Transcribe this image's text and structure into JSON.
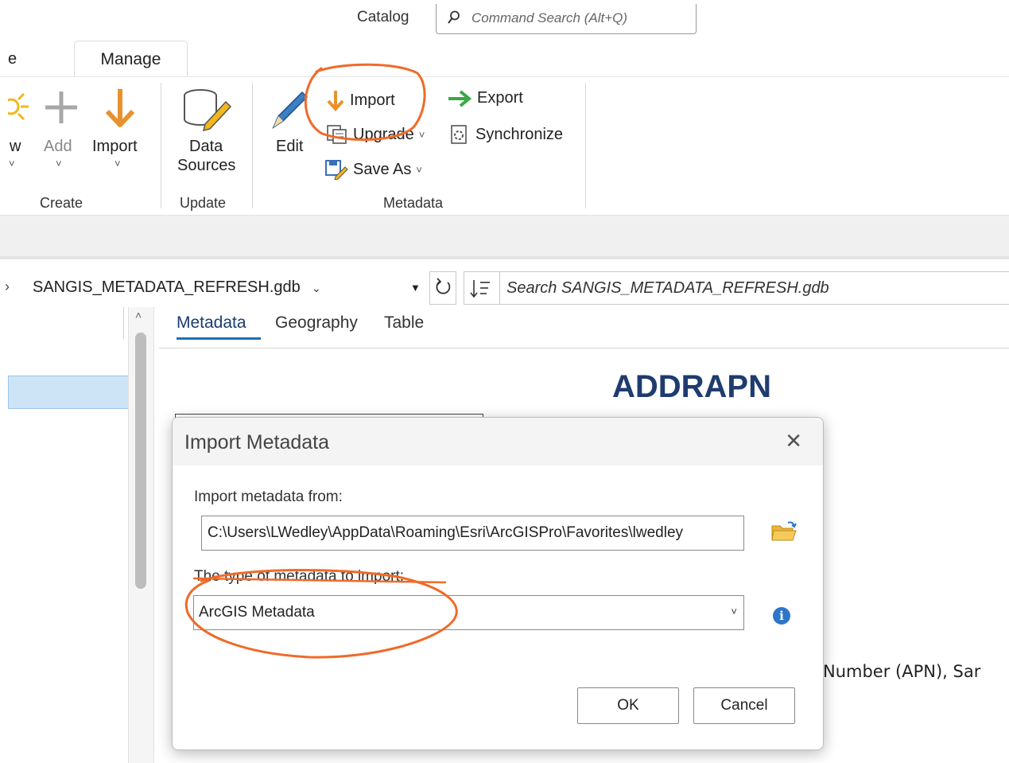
{
  "title_bar": {
    "catalog_label": "Catalog",
    "command_search_placeholder": "Command Search (Alt+Q)"
  },
  "tabs": {
    "partial_tab": "e",
    "active_tab": "Manage"
  },
  "ribbon": {
    "create_group": {
      "label": "Create",
      "new_partial": "w",
      "add_label": "Add",
      "import_label": "Import"
    },
    "update_group": {
      "label": "Update",
      "data_sources_line1": "Data",
      "data_sources_line2": "Sources"
    },
    "metadata_group": {
      "label": "Metadata",
      "edit_label": "Edit",
      "import_label": "Import",
      "upgrade_label": "Upgrade",
      "save_as_label": "Save As",
      "export_label": "Export",
      "synchronize_label": "Synchronize"
    }
  },
  "location_bar": {
    "path": "SANGIS_METADATA_REFRESH.gdb",
    "search_placeholder": "Search SANGIS_METADATA_REFRESH.gdb"
  },
  "content_tabs": [
    {
      "label": "Metadata",
      "active": true
    },
    {
      "label": "Geography",
      "active": false
    },
    {
      "label": "Table",
      "active": false
    }
  ],
  "document": {
    "title": "ADDRAPN",
    "partial_text": "Number (APN), Sar"
  },
  "dialog": {
    "title": "Import Metadata",
    "from_label": "Import metadata from:",
    "from_value": "C:\\Users\\LWedley\\AppData\\Roaming\\Esri\\ArcGISPro\\Favorites\\lwedley",
    "type_label": "The type of metadata to import:",
    "type_value": "ArcGIS Metadata",
    "info_glyph": "i",
    "ok_label": "OK",
    "cancel_label": "Cancel"
  },
  "colors": {
    "accent_blue": "#1f6fb5",
    "title_navy": "#1f3c6e",
    "annotation_orange": "#f06a28",
    "import_arrow_orange": "#e8922d",
    "export_arrow_green": "#3aa845"
  },
  "icons": [
    "search-icon",
    "sun-icon",
    "plus-icon",
    "import-arrow-icon",
    "database-pencil-icon",
    "pencil-icon",
    "upgrade-icon",
    "save-as-icon",
    "export-arrow-icon",
    "synchronize-icon",
    "refresh-icon",
    "sort-icon",
    "folder-icon",
    "info-icon",
    "close-icon"
  ]
}
